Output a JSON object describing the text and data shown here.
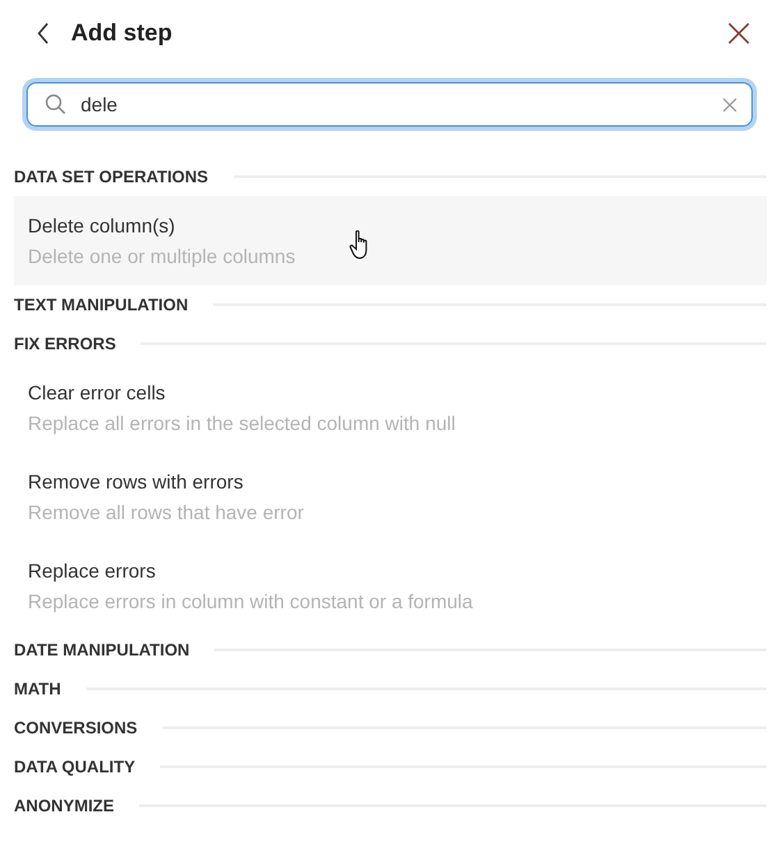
{
  "header": {
    "title": "Add step"
  },
  "search": {
    "value": "dele"
  },
  "sections": [
    {
      "title": "DATA SET OPERATIONS",
      "items": [
        {
          "name": "Delete column(s)",
          "description": "Delete one or multiple columns",
          "hovered": true
        }
      ]
    },
    {
      "title": "TEXT MANIPULATION"
    },
    {
      "title": "FIX ERRORS",
      "items": [
        {
          "name": "Clear error cells",
          "description": "Replace all errors in the selected column with null",
          "hovered": false
        },
        {
          "name": "Remove rows with errors",
          "description": "Remove all rows that have error",
          "hovered": false
        },
        {
          "name": "Replace errors",
          "description": "Replace errors in column with constant or a formula",
          "hovered": false
        }
      ]
    },
    {
      "title": "DATE MANIPULATION"
    },
    {
      "title": "MATH"
    },
    {
      "title": "CONVERSIONS"
    },
    {
      "title": "DATA QUALITY"
    },
    {
      "title": "ANONYMIZE"
    }
  ]
}
